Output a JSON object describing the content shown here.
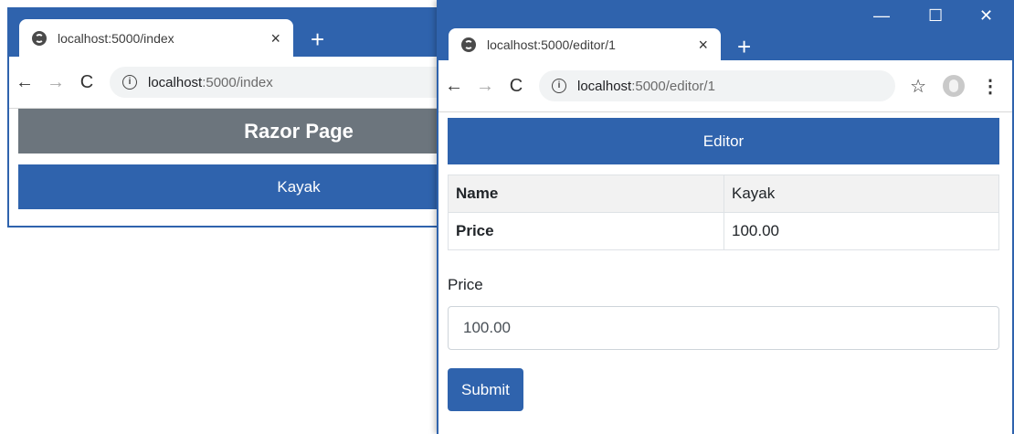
{
  "back_window": {
    "tab": {
      "title": "localhost:5000/index",
      "close": "×"
    },
    "new_tab": "+",
    "nav": {
      "back": "←",
      "forward": "→",
      "reload": "C"
    },
    "address": {
      "info": "i",
      "host": "localhost",
      "path": ":5000/index"
    },
    "page": {
      "heading": "Razor Page",
      "product": "Kayak"
    }
  },
  "front_window": {
    "tab": {
      "title": "localhost:5000/editor/1",
      "close": "×"
    },
    "new_tab": "+",
    "window_controls": {
      "minimize": "—",
      "maximize": "☐",
      "close": "✕"
    },
    "nav": {
      "back": "←",
      "forward": "→",
      "reload": "C"
    },
    "address": {
      "info": "i",
      "host": "localhost",
      "path": ":5000/editor/1"
    },
    "toolbar_icons": {
      "bookmark": "☆",
      "menu": "⋮"
    },
    "page": {
      "heading": "Editor",
      "rows": [
        {
          "label": "Name",
          "value": "Kayak"
        },
        {
          "label": "Price",
          "value": "100.00"
        }
      ],
      "field_label": "Price",
      "field_value": "100.00",
      "submit_label": "Submit"
    }
  },
  "colors": {
    "chrome_blue": "#2f63ad",
    "gray_header": "#6c757d",
    "omnibox": "#f1f3f4"
  }
}
